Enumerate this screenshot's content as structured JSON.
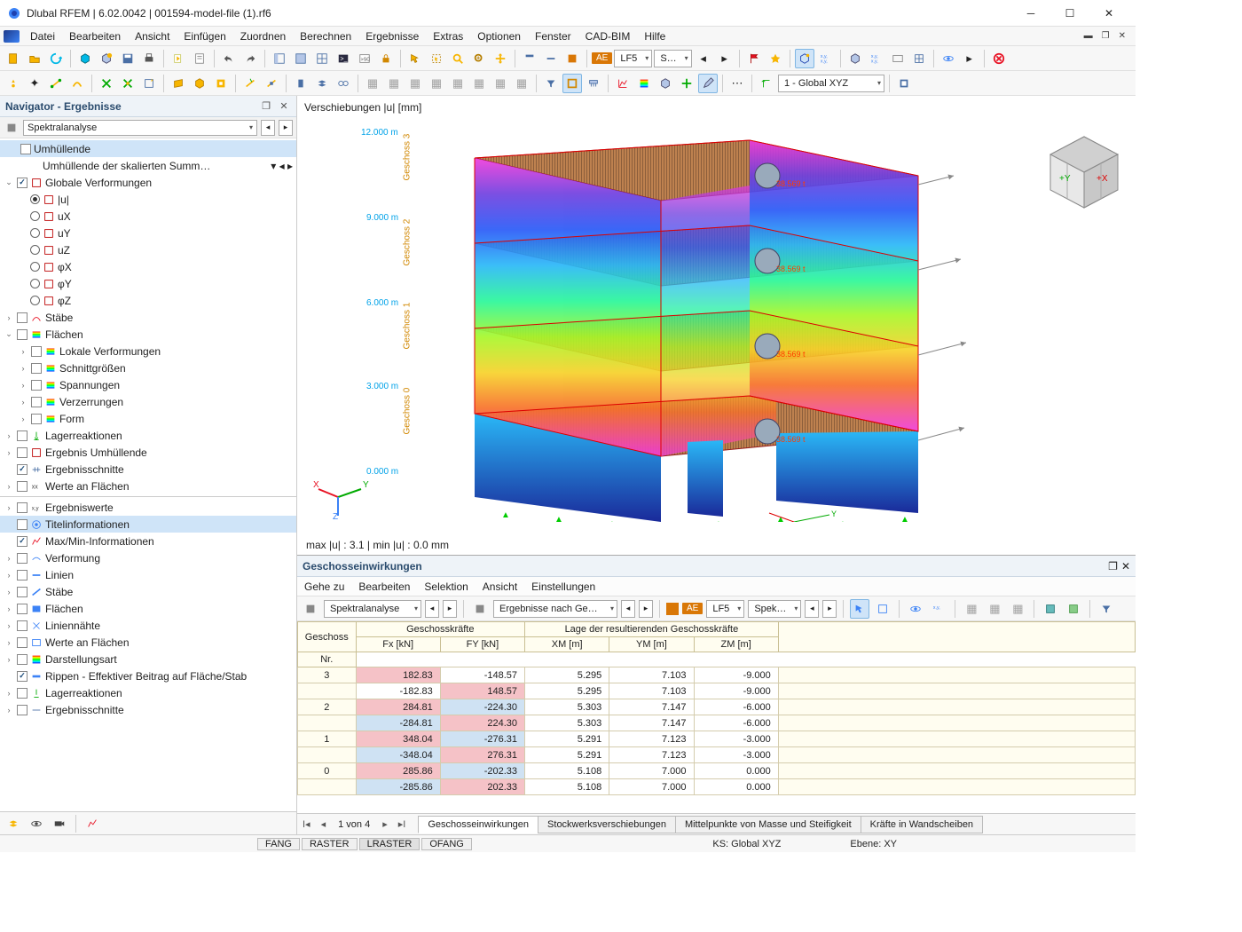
{
  "window": {
    "title": "Dlubal RFEM | 6.02.0042 | 001594-model-file (1).rf6"
  },
  "menubar": [
    "Datei",
    "Bearbeiten",
    "Ansicht",
    "Einfügen",
    "Zuordnen",
    "Berechnen",
    "Ergebnisse",
    "Extras",
    "Optionen",
    "Fenster",
    "CAD-BIM",
    "Hilfe"
  ],
  "toolbar1": {
    "combo_ae": "AE",
    "combo_lf": "LF5",
    "combo_s": "S…"
  },
  "toolbar2": {
    "cs": "1 - Global XYZ"
  },
  "navigator": {
    "title": "Navigator - Ergebnisse",
    "spectral": "Spektralanalyse",
    "envelope": "Umhüllende",
    "envelope_sub": "Umhüllende der skalierten Summ…",
    "tree": {
      "global_def": "Globale Verformungen",
      "u": "|u|",
      "ux": "uX",
      "uy": "uY",
      "uz": "uZ",
      "phix": "φX",
      "phiy": "φY",
      "phiz": "φZ",
      "staebe": "Stäbe",
      "flaechen": "Flächen",
      "lokal_def": "Lokale Verformungen",
      "schnittgr": "Schnittgrößen",
      "spannungen": "Spannungen",
      "verzerrungen": "Verzerrungen",
      "form": "Form",
      "lagerreakt": "Lagerreaktionen",
      "erg_umh": "Ergebnis Umhüllende",
      "erg_schnitte": "Ergebnisschnitte",
      "werte_flaechen": "Werte an Flächen",
      "erg_werte": "Ergebniswerte",
      "titelinfo": "Titelinformationen",
      "maxmin": "Max/Min-Informationen",
      "verformung": "Verformung",
      "linien": "Linien",
      "staebe2": "Stäbe",
      "flaechen2": "Flächen",
      "liniennaht": "Liniennähte",
      "werte_fl2": "Werte an Flächen",
      "darstellung": "Darstellungsart",
      "rippen": "Rippen - Effektiver Beitrag auf Fläche/Stab",
      "lagerreakt2": "Lagerreaktionen",
      "erg_schnitte2": "Ergebnisschnitte"
    }
  },
  "viewport": {
    "title": "Verschiebungen |u| [mm]",
    "levels": [
      {
        "txt": "12.000 m",
        "tag": "Geschoss 3"
      },
      {
        "txt": "9.000 m",
        "tag": "Geschoss 2"
      },
      {
        "txt": "6.000 m",
        "tag": "Geschoss 1"
      },
      {
        "txt": "3.000 m",
        "tag": "Geschoss 0"
      },
      {
        "txt": "0.000 m",
        "tag": ""
      }
    ],
    "mass_label": "38.569 t",
    "summary": "max |u| : 3.1 | min |u| : 0.0 mm",
    "triad": {
      "x": "X",
      "y": "Y",
      "z": "Z"
    },
    "navcube": {
      "px": "+X",
      "py": "+Y"
    }
  },
  "bottom": {
    "title": "Geschosseinwirkungen",
    "menu": [
      "Gehe zu",
      "Bearbeiten",
      "Selektion",
      "Ansicht",
      "Einstellungen"
    ],
    "tb": {
      "combo1": "Spektralanalyse",
      "combo2": "Ergebnisse nach Ge…",
      "ae": "AE",
      "lf": "LF5",
      "sp": "Spek…"
    },
    "headers": {
      "geschoss": "Geschoss",
      "nr": "Nr.",
      "kräfte": "Geschosskräfte",
      "fx": "Fx [kN]",
      "fy": "FY [kN]",
      "lage": "Lage der resultierenden Geschosskräfte",
      "xm": "XM [m]",
      "ym": "YM [m]",
      "zm": "ZM [m]"
    },
    "rows": [
      {
        "g": "3",
        "fx": "182.83",
        "fy": "-148.57",
        "xm": "5.295",
        "ym": "7.103",
        "zm": "-9.000",
        "fxhl": "pink",
        "fyhl": ""
      },
      {
        "g": "",
        "fx": "-182.83",
        "fy": "148.57",
        "xm": "5.295",
        "ym": "7.103",
        "zm": "-9.000",
        "fxhl": "",
        "fyhl": "pink"
      },
      {
        "g": "2",
        "fx": "284.81",
        "fy": "-224.30",
        "xm": "5.303",
        "ym": "7.147",
        "zm": "-6.000",
        "fxhl": "pink",
        "fyhl": "blue"
      },
      {
        "g": "",
        "fx": "-284.81",
        "fy": "224.30",
        "xm": "5.303",
        "ym": "7.147",
        "zm": "-6.000",
        "fxhl": "blue",
        "fyhl": "pink"
      },
      {
        "g": "1",
        "fx": "348.04",
        "fy": "-276.31",
        "xm": "5.291",
        "ym": "7.123",
        "zm": "-3.000",
        "fxhl": "pink",
        "fyhl": "blue"
      },
      {
        "g": "",
        "fx": "-348.04",
        "fy": "276.31",
        "xm": "5.291",
        "ym": "7.123",
        "zm": "-3.000",
        "fxhl": "blue",
        "fyhl": "pink"
      },
      {
        "g": "0",
        "fx": "285.86",
        "fy": "-202.33",
        "xm": "5.108",
        "ym": "7.000",
        "zm": "0.000",
        "fxhl": "pink",
        "fyhl": "blue"
      },
      {
        "g": "",
        "fx": "-285.86",
        "fy": "202.33",
        "xm": "5.108",
        "ym": "7.000",
        "zm": "0.000",
        "fxhl": "blue",
        "fyhl": "pink"
      }
    ],
    "nav": {
      "page": "1 von 4"
    },
    "tabs": [
      "Geschosseinwirkungen",
      "Stockwerksverschiebungen",
      "Mittelpunkte von Masse und Steifigkeit",
      "Kräfte in Wandscheiben"
    ]
  },
  "status": {
    "fang": "FANG",
    "raster": "RASTER",
    "lraster": "LRASTER",
    "ofang": "OFANG",
    "ks": "KS: Global XYZ",
    "ebene": "Ebene: XY"
  }
}
